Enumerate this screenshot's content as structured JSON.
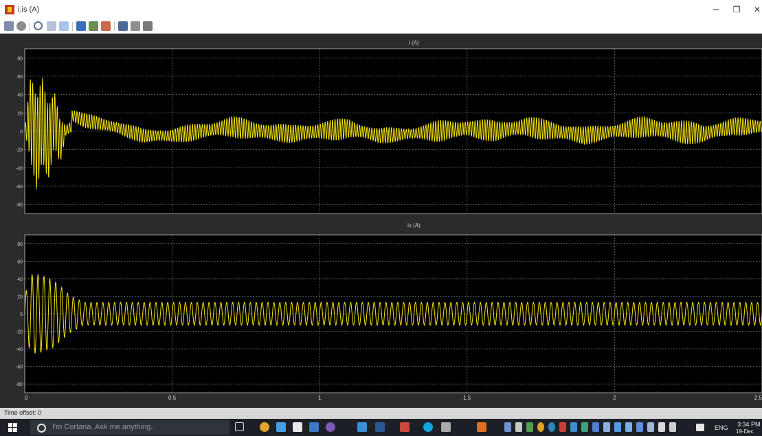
{
  "window": {
    "title": "i;is (A)",
    "minimize_glyph": "–",
    "restore_glyph": "❐",
    "close_glyph": "✕"
  },
  "toolbar": {
    "buttons": [
      "print-icon",
      "parameters-icon",
      "zoom-icon",
      "zoom-x-icon",
      "zoom-y-icon",
      "autoscale-icon",
      "save-axes-icon",
      "restore-axes-icon",
      "floating-scope-icon",
      "lock-axes-icon",
      "signal-selection-icon"
    ]
  },
  "colors": {
    "trace": "#f5e50a",
    "plot_bg": "#000000",
    "frame_bg": "#2b2b2b",
    "grid": "#8c8c8c"
  },
  "plots": [
    {
      "title": "i (A)",
      "yticks": [
        "80",
        "60",
        "40",
        "20",
        "0",
        "-20",
        "-40",
        "-60",
        "-80"
      ],
      "ylim": [
        -90,
        90
      ]
    },
    {
      "title": "is (A)",
      "yticks": [
        "80",
        "60",
        "40",
        "20",
        "0",
        "-20",
        "-40",
        "-60",
        "-80"
      ],
      "ylim": [
        -90,
        90
      ]
    }
  ],
  "xaxis": {
    "ticks": [
      "0",
      "0.5",
      "1",
      "1.5",
      "2",
      "2.5"
    ],
    "xlim": [
      0,
      2.5
    ]
  },
  "statusbar": {
    "time_offset": "Time offset:  0"
  },
  "taskbar": {
    "cortana_placeholder": "I'm Cortana. Ask me anything.",
    "language": "ENG",
    "clock_time": "3:34 PM",
    "clock_date": "19-Dec"
  },
  "chart_data": [
    {
      "type": "line",
      "title": "i (A)",
      "xlim": [
        0,
        2.5
      ],
      "ylim": [
        -90,
        90
      ],
      "series": [
        {
          "x": [
            0,
            0.02,
            0.04,
            0.06,
            0.08,
            0.1,
            0.12,
            0.14,
            0.16,
            0.2,
            0.3,
            0.4,
            0.5,
            0.6,
            0.7,
            0.8,
            0.9,
            1.0,
            1.1,
            1.2,
            1.3,
            1.4,
            1.5,
            1.6,
            1.7,
            1.8,
            1.9,
            2.0,
            2.1,
            2.2,
            2.3,
            2.4,
            2.5
          ],
          "y": [
            0,
            50,
            -50,
            45,
            -48,
            45,
            -40,
            5,
            17,
            12,
            5,
            -5,
            -5,
            0,
            5,
            0,
            -3,
            0,
            3,
            -5,
            -3,
            0,
            3,
            0,
            5,
            0,
            -5,
            0,
            5,
            0,
            -3,
            5,
            5
          ],
          "envelope": [
            4,
            50,
            50,
            48,
            48,
            45,
            40,
            8,
            8,
            8,
            9,
            8,
            9,
            10,
            12,
            12,
            10,
            12,
            12,
            9,
            8,
            12,
            12,
            12,
            12,
            12,
            10,
            10,
            12,
            14,
            12,
            10,
            10
          ]
        }
      ]
    },
    {
      "type": "line",
      "title": "is (A)",
      "xlim": [
        0,
        2.5
      ],
      "ylim": [
        -90,
        90
      ],
      "series": [
        {
          "x": [
            0,
            0.02,
            0.05,
            0.1,
            0.15,
            0.2,
            0.3,
            0.5,
            1.0,
            1.5,
            2.0,
            2.5
          ],
          "y": [
            0,
            0,
            0,
            0,
            0,
            0,
            0,
            0,
            0,
            0,
            0,
            0
          ],
          "envelope": [
            20,
            45,
            45,
            38,
            22,
            13,
            13,
            13,
            13,
            13,
            13,
            13
          ]
        }
      ]
    }
  ]
}
